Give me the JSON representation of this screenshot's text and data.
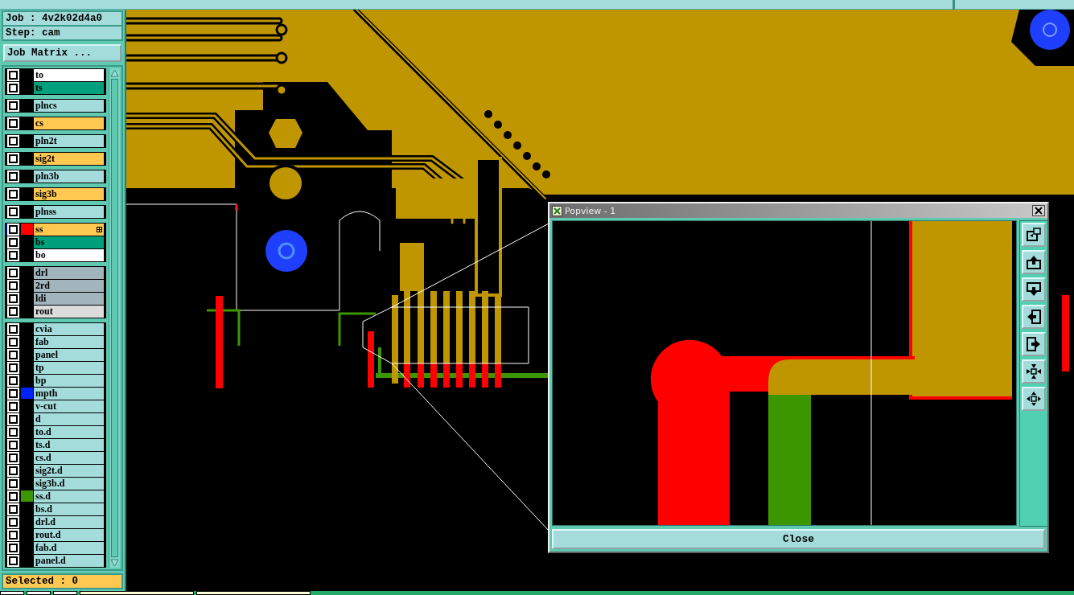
{
  "panel": {
    "job_label": "Job : 4v2k02d4a0",
    "step_label": "Step: cam",
    "job_matrix_button": "Job Matrix ...",
    "status": "Selected : 0"
  },
  "layer_groups": [
    {
      "layers": [
        {
          "name": "to",
          "kind": "silk",
          "checked": false,
          "selected": false
        },
        {
          "name": "ts",
          "kind": "mask",
          "checked": false,
          "selected": false
        }
      ]
    },
    {
      "layers": [
        {
          "name": "plncs",
          "kind": "plane",
          "checked": false,
          "selected": false
        }
      ]
    },
    {
      "layers": [
        {
          "name": "cs",
          "kind": "signal",
          "checked": false,
          "selected": false
        }
      ]
    },
    {
      "layers": [
        {
          "name": "pln2t",
          "kind": "plane",
          "checked": false,
          "selected": false
        }
      ]
    },
    {
      "layers": [
        {
          "name": "sig2t",
          "kind": "signal",
          "checked": false,
          "selected": false
        }
      ]
    },
    {
      "layers": [
        {
          "name": "pln3b",
          "kind": "plane",
          "checked": false,
          "selected": false
        }
      ]
    },
    {
      "layers": [
        {
          "name": "sig3b",
          "kind": "signal",
          "checked": false,
          "selected": false
        }
      ]
    },
    {
      "layers": [
        {
          "name": "plnss",
          "kind": "plane",
          "checked": false,
          "selected": false
        }
      ]
    },
    {
      "layers": [
        {
          "name": "ss",
          "kind": "signal",
          "checked": false,
          "selected": true,
          "color": "#ff0000"
        },
        {
          "name": "bs",
          "kind": "mask",
          "checked": false,
          "selected": false
        },
        {
          "name": "bo",
          "kind": "silk",
          "checked": false,
          "selected": false
        }
      ]
    },
    {
      "layers": [
        {
          "name": "drl",
          "kind": "drill",
          "checked": false,
          "selected": false
        },
        {
          "name": "2rd",
          "kind": "drill",
          "checked": false,
          "selected": false
        },
        {
          "name": "ldi",
          "kind": "drill",
          "checked": false,
          "selected": false
        },
        {
          "name": "rout",
          "kind": "rout",
          "checked": false,
          "selected": false
        }
      ]
    },
    {
      "layers": [
        {
          "name": "cvia",
          "kind": "document",
          "checked": false,
          "selected": false
        },
        {
          "name": "fab",
          "kind": "document",
          "checked": false,
          "selected": false
        },
        {
          "name": "panel",
          "kind": "document",
          "checked": false,
          "selected": false
        },
        {
          "name": "tp",
          "kind": "document",
          "checked": false,
          "selected": false
        },
        {
          "name": "bp",
          "kind": "document",
          "checked": false,
          "selected": false
        },
        {
          "name": "mpth",
          "kind": "document",
          "checked": false,
          "selected": false,
          "color": "#0022ff"
        },
        {
          "name": "v-cut",
          "kind": "document",
          "checked": false,
          "selected": false
        },
        {
          "name": "d",
          "kind": "document",
          "checked": false,
          "selected": false
        },
        {
          "name": "to.d",
          "kind": "document",
          "checked": false,
          "selected": false
        },
        {
          "name": "ts.d",
          "kind": "document",
          "checked": false,
          "selected": false
        },
        {
          "name": "cs.d",
          "kind": "document",
          "checked": false,
          "selected": false
        },
        {
          "name": "sig2t.d",
          "kind": "document",
          "checked": false,
          "selected": false
        },
        {
          "name": "sig3b.d",
          "kind": "document",
          "checked": false,
          "selected": false
        },
        {
          "name": "ss.d",
          "kind": "document",
          "checked": false,
          "selected": false,
          "color": "#3c9600"
        },
        {
          "name": "bs.d",
          "kind": "document",
          "checked": false,
          "selected": false
        },
        {
          "name": "drl.d",
          "kind": "document",
          "checked": false,
          "selected": false
        },
        {
          "name": "rout.d",
          "kind": "document",
          "checked": false,
          "selected": false
        },
        {
          "name": "fab.d",
          "kind": "document",
          "checked": false,
          "selected": false
        },
        {
          "name": "panel.d",
          "kind": "document",
          "checked": false,
          "selected": false
        }
      ]
    }
  ],
  "popview": {
    "title": "Popview - 1",
    "close_button": "Close"
  }
}
